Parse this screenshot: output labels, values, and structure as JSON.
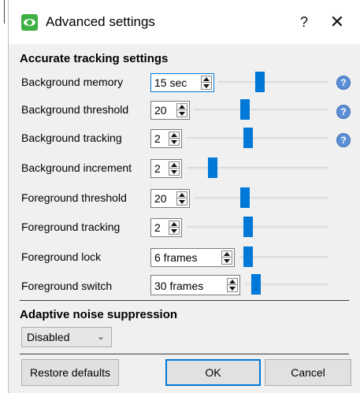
{
  "window": {
    "title": "Advanced settings",
    "help_label": "?",
    "close_label": "✕"
  },
  "accurate": {
    "section_title": "Accurate tracking settings",
    "rows": [
      {
        "label": "Background memory",
        "value": "15 sec",
        "slider_level": 0.37,
        "help": "?"
      },
      {
        "label": "Background threshold",
        "value": "20",
        "slider_level": 0.37,
        "help": "?"
      },
      {
        "label": "Background tracking",
        "value": "2",
        "slider_level": 0.43,
        "help": "?"
      },
      {
        "label": "Background increment",
        "value": "2",
        "slider_level": 0.16
      },
      {
        "label": "Foreground threshold",
        "value": "20",
        "slider_level": 0.37
      },
      {
        "label": "Foreground tracking",
        "value": "2",
        "slider_level": 0.43
      },
      {
        "label": "Foreground lock",
        "value": "6 frames",
        "slider_level": 0.05
      },
      {
        "label": "Foreground switch",
        "value": "30 frames",
        "slider_level": 0.08
      }
    ]
  },
  "adaptive": {
    "section_title": "Adaptive noise suppression",
    "selected": "Disabled"
  },
  "buttons": {
    "restore": "Restore defaults",
    "ok": "OK",
    "cancel": "Cancel"
  },
  "colors": {
    "accent": "#0078d7",
    "app_icon": "#3cb043",
    "help_icon": "#5b8fd6"
  }
}
